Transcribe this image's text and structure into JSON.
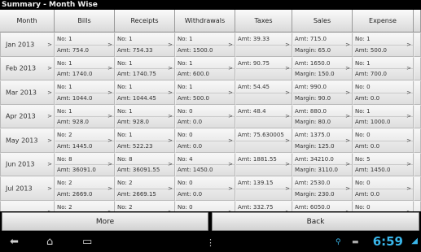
{
  "title": "Summary - Month Wise",
  "headers": [
    "Month",
    "Bills",
    "Receipts",
    "Withdrawals",
    "Taxes",
    "Sales",
    "Expense"
  ],
  "rows": [
    {
      "month": "Jan 2013",
      "bills": [
        "No: 1",
        "Amt: 754.0"
      ],
      "receipts": [
        "No: 1",
        "Amt: 754.33"
      ],
      "withdrawals": [
        "No: 1",
        "Amt: 1500.0"
      ],
      "taxes": [
        "Amt: 39.33",
        ""
      ],
      "sales": [
        "Amt: 715.0",
        "Margin: 65.0"
      ],
      "expense": [
        "No: 1",
        "Amt: 500.0"
      ]
    },
    {
      "month": "Feb 2013",
      "bills": [
        "No: 1",
        "Amt: 1740.0"
      ],
      "receipts": [
        "No: 1",
        "Amt: 1740.75"
      ],
      "withdrawals": [
        "No: 1",
        "Amt: 600.0"
      ],
      "taxes": [
        "Amt: 90.75",
        ""
      ],
      "sales": [
        "Amt: 1650.0",
        "Margin: 150.0"
      ],
      "expense": [
        "No: 1",
        "Amt: 700.0"
      ]
    },
    {
      "month": "Mar 2013",
      "bills": [
        "No: 1",
        "Amt: 1044.0"
      ],
      "receipts": [
        "No: 1",
        "Amt: 1044.45"
      ],
      "withdrawals": [
        "No: 1",
        "Amt: 500.0"
      ],
      "taxes": [
        "Amt: 54.45",
        ""
      ],
      "sales": [
        "Amt: 990.0",
        "Margin: 90.0"
      ],
      "expense": [
        "No: 0",
        "Amt: 0.0"
      ]
    },
    {
      "month": "Apr 2013",
      "bills": [
        "No: 1",
        "Amt: 928.0"
      ],
      "receipts": [
        "No: 1",
        "Amt: 928.0"
      ],
      "withdrawals": [
        "No: 0",
        "Amt: 0.0"
      ],
      "taxes": [
        "Amt: 48.4",
        ""
      ],
      "sales": [
        "Amt: 880.0",
        "Margin: 80.0"
      ],
      "expense": [
        "No: 1",
        "Amt: 1000.0"
      ]
    },
    {
      "month": "May 2013",
      "bills": [
        "No: 2",
        "Amt: 1445.0"
      ],
      "receipts": [
        "No: 1",
        "Amt: 522.23"
      ],
      "withdrawals": [
        "No: 0",
        "Amt: 0.0"
      ],
      "taxes": [
        "Amt: 75.630005",
        ""
      ],
      "sales": [
        "Amt: 1375.0",
        "Margin: 125.0"
      ],
      "expense": [
        "No: 0",
        "Amt: 0.0"
      ]
    },
    {
      "month": "Jun 2013",
      "bills": [
        "No: 8",
        "Amt: 36091.0"
      ],
      "receipts": [
        "No: 8",
        "Amt: 36091.55"
      ],
      "withdrawals": [
        "No: 4",
        "Amt: 1450.0"
      ],
      "taxes": [
        "Amt: 1881.55",
        ""
      ],
      "sales": [
        "Amt: 34210.0",
        "Margin: 3110.0"
      ],
      "expense": [
        "No: 5",
        "Amt: 1450.0"
      ]
    },
    {
      "month": "Jul 2013",
      "bills": [
        "No: 2",
        "Amt: 2669.0"
      ],
      "receipts": [
        "No: 2",
        "Amt: 2669.15"
      ],
      "withdrawals": [
        "No: 0",
        "Amt: 0.0"
      ],
      "taxes": [
        "Amt: 139.15",
        ""
      ],
      "sales": [
        "Amt: 2530.0",
        "Margin: 230.0"
      ],
      "expense": [
        "No: 0",
        "Amt: 0.0"
      ]
    },
    {
      "month": "",
      "bills": [
        "No: 2",
        ""
      ],
      "receipts": [
        "No: 2",
        ""
      ],
      "withdrawals": [
        "No: 0",
        ""
      ],
      "taxes": [
        "Amt: 332.75",
        ""
      ],
      "sales": [
        "Amt: 6050.0",
        ""
      ],
      "expense": [
        "No: 0",
        ""
      ]
    }
  ],
  "chevron": ">",
  "buttons": {
    "more": "More",
    "back": "Back"
  },
  "status": {
    "time": "6:59"
  }
}
